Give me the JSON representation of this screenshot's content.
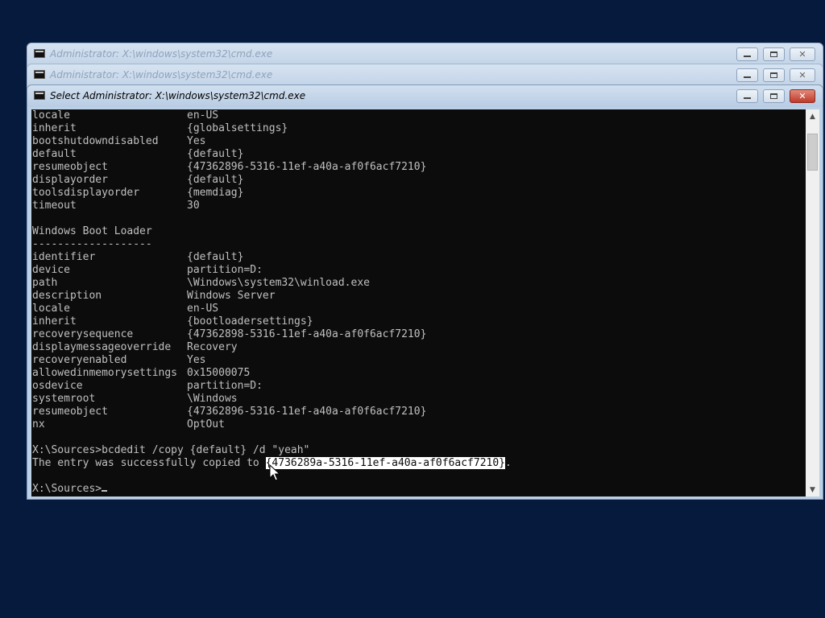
{
  "windows": {
    "back1": {
      "title": "Administrator: X:\\windows\\system32\\cmd.exe"
    },
    "back2": {
      "title": "Administrator: X:\\windows\\system32\\cmd.exe"
    },
    "front": {
      "title": "Select Administrator: X:\\windows\\system32\\cmd.exe"
    }
  },
  "console": {
    "group1": [
      {
        "key": "locale",
        "value": "en-US"
      },
      {
        "key": "inherit",
        "value": "{globalsettings}"
      },
      {
        "key": "bootshutdowndisabled",
        "value": "Yes"
      },
      {
        "key": "default",
        "value": "{default}"
      },
      {
        "key": "resumeobject",
        "value": "{47362896-5316-11ef-a40a-af0f6acf7210}"
      },
      {
        "key": "displayorder",
        "value": "{default}"
      },
      {
        "key": "toolsdisplayorder",
        "value": "{memdiag}"
      },
      {
        "key": "timeout",
        "value": "30"
      }
    ],
    "section_title": "Windows Boot Loader",
    "section_rule": "-------------------",
    "group2": [
      {
        "key": "identifier",
        "value": "{default}"
      },
      {
        "key": "device",
        "value": "partition=D:"
      },
      {
        "key": "path",
        "value": "\\Windows\\system32\\winload.exe"
      },
      {
        "key": "description",
        "value": "Windows Server"
      },
      {
        "key": "locale",
        "value": "en-US"
      },
      {
        "key": "inherit",
        "value": "{bootloadersettings}"
      },
      {
        "key": "recoverysequence",
        "value": "{47362898-5316-11ef-a40a-af0f6acf7210}"
      },
      {
        "key": "displaymessageoverride",
        "value": "Recovery"
      },
      {
        "key": "recoveryenabled",
        "value": "Yes"
      },
      {
        "key": "allowedinmemorysettings",
        "value": "0x15000075"
      },
      {
        "key": "osdevice",
        "value": "partition=D:"
      },
      {
        "key": "systemroot",
        "value": "\\Windows"
      },
      {
        "key": "resumeobject",
        "value": "{47362896-5316-11ef-a40a-af0f6acf7210}"
      },
      {
        "key": "nx",
        "value": "OptOut"
      }
    ],
    "command": "X:\\Sources>bcdedit /copy {default} /d \"yeah\"",
    "result_prefix": "The entry was successfully copied to ",
    "result_selected": "{4736289a-5316-11ef-a40a-af0f6acf7210}",
    "result_suffix": ".",
    "prompt": "X:\\Sources>"
  },
  "colors": {
    "desktop": "#051a3d",
    "console_bg": "#0c0c0c",
    "console_text": "#c0c0c0",
    "close_button": "#c0392b"
  },
  "icons": {
    "app": "cmd-console-icon",
    "minimize": "minimize-icon",
    "maximize": "maximize-icon",
    "close": "close-icon",
    "scroll_up": "scroll-up-arrow-icon",
    "scroll_down": "scroll-down-arrow-icon",
    "pointer": "mouse-pointer-icon"
  }
}
